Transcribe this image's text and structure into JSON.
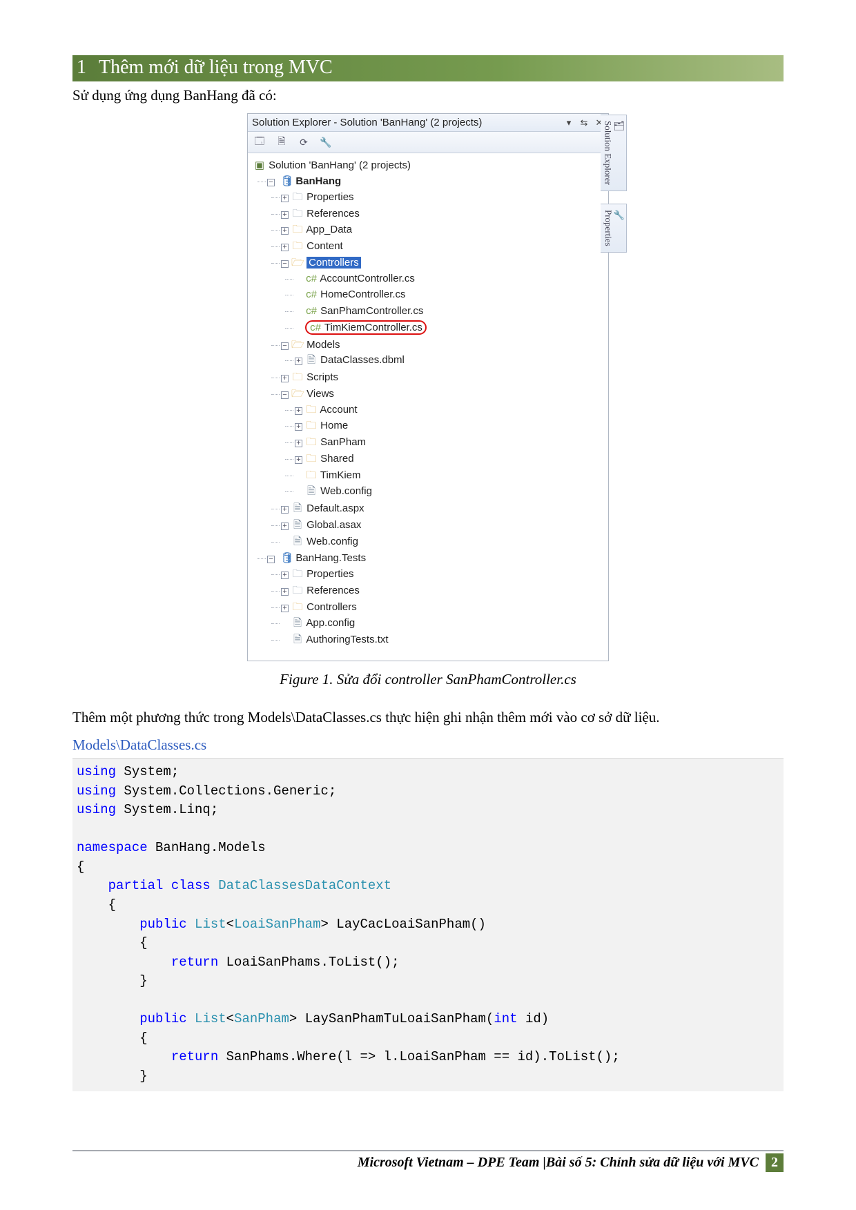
{
  "heading": {
    "num": "1",
    "title": "Thêm mới dữ liệu trong MVC"
  },
  "intro": "Sử dụng ứng dụng BanHang đã có:",
  "explorer": {
    "header": "Solution Explorer - Solution 'BanHang' (2 projects)",
    "tree": {
      "root": "Solution 'BanHang' (2 projects)",
      "proj1": "BanHang",
      "p1_properties": "Properties",
      "p1_references": "References",
      "p1_app_data": "App_Data",
      "p1_content": "Content",
      "p1_controllers": "Controllers",
      "ctrl_account": "AccountController.cs",
      "ctrl_home": "HomeController.cs",
      "ctrl_sanpham": "SanPhamController.cs",
      "ctrl_timkiem": "TimKiemController.cs",
      "p1_models": "Models",
      "models_dbml": "DataClasses.dbml",
      "p1_scripts": "Scripts",
      "p1_views": "Views",
      "view_account": "Account",
      "view_home": "Home",
      "view_sanpham": "SanPham",
      "view_shared": "Shared",
      "view_timkiem": "TimKiem",
      "view_webconfig": "Web.config",
      "p1_default": "Default.aspx",
      "p1_global": "Global.asax",
      "p1_webconfig": "Web.config",
      "proj2": "BanHang.Tests",
      "p2_properties": "Properties",
      "p2_references": "References",
      "p2_controllers": "Controllers",
      "p2_appconfig": "App.config",
      "p2_authtests": "AuthoringTests.txt"
    },
    "sidetabs": {
      "t1": "Solution Explorer",
      "t2": "Properties"
    }
  },
  "caption": "Figure 1. Sửa đổi controller SanPhamController.cs",
  "para2": "Thêm một phương thức trong Models\\DataClasses.cs thực hiện ghi nhận thêm mới vào cơ sở dữ liệu.",
  "filelink": "Models\\DataClasses.cs",
  "code": {
    "l01a": "using",
    "l01b": " System;",
    "l02a": "using",
    "l02b": " System.Collections.Generic;",
    "l03a": "using",
    "l03b": " System.Linq;",
    "l05a": "namespace",
    "l05b": " BanHang.Models",
    "l06": "{",
    "l07a": "    partial",
    "l07b": " class",
    "l07c": " DataClassesDataContext",
    "l08": "    {",
    "l09a": "        public",
    "l09b": " List",
    "l09c": "<",
    "l09d": "LoaiSanPham",
    "l09e": "> LayCacLoaiSanPham()",
    "l10": "        {",
    "l11a": "            return",
    "l11b": " LoaiSanPhams.ToList();",
    "l12": "        }",
    "l14a": "        public",
    "l14b": " List",
    "l14c": "<",
    "l14d": "SanPham",
    "l14e": "> LaySanPhamTuLoaiSanPham(",
    "l14f": "int",
    "l14g": " id)",
    "l15": "        {",
    "l16a": "            return",
    "l16b": " SanPhams.Where(l => l.LoaiSanPham == id).ToList();",
    "l17": "        }"
  },
  "footer": {
    "text": "Microsoft Vietnam – DPE Team |Bài số 5: Chỉnh sửa dữ liệu với MVC",
    "page": "2"
  }
}
